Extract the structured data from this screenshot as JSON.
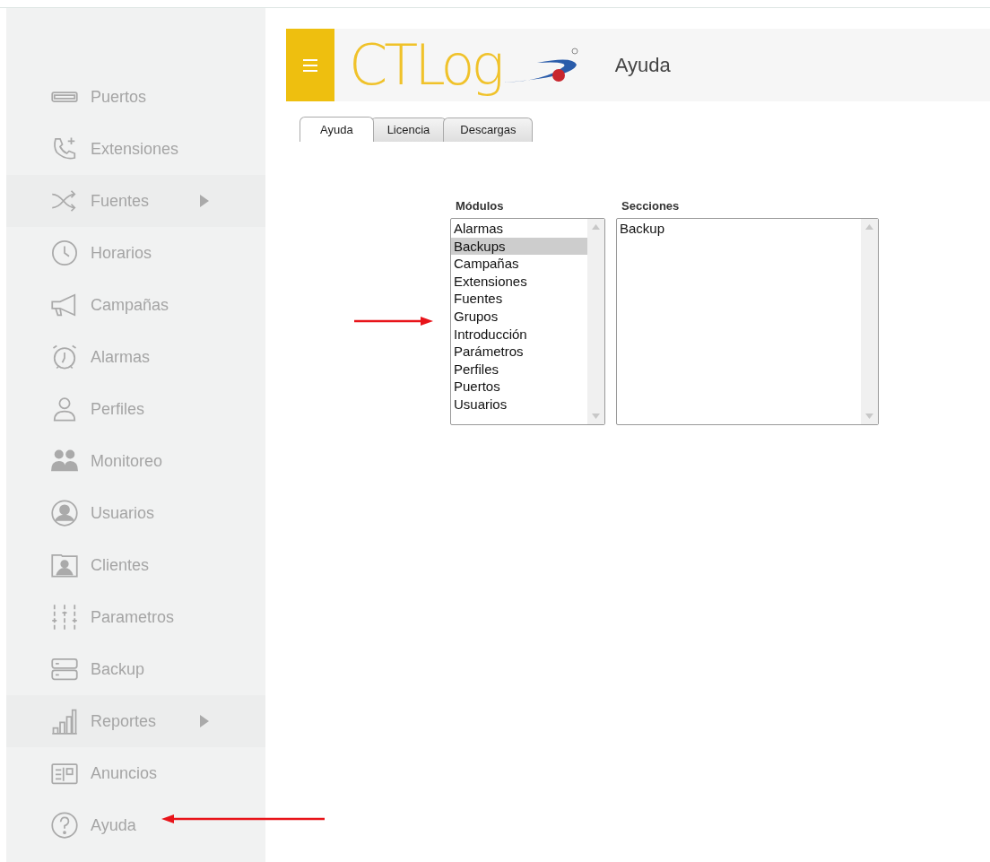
{
  "sidebar": {
    "items": [
      {
        "label": "Puertos",
        "has_submenu": false
      },
      {
        "label": "Extensiones",
        "has_submenu": false
      },
      {
        "label": "Fuentes",
        "has_submenu": true
      },
      {
        "label": "Horarios",
        "has_submenu": false
      },
      {
        "label": "Campañas",
        "has_submenu": false
      },
      {
        "label": "Alarmas",
        "has_submenu": false
      },
      {
        "label": "Perfiles",
        "has_submenu": false
      },
      {
        "label": "Monitoreo",
        "has_submenu": false
      },
      {
        "label": "Usuarios",
        "has_submenu": false
      },
      {
        "label": "Clientes",
        "has_submenu": false
      },
      {
        "label": "Parametros",
        "has_submenu": false
      },
      {
        "label": "Backup",
        "has_submenu": false
      },
      {
        "label": "Reportes",
        "has_submenu": true
      },
      {
        "label": "Anuncios",
        "has_submenu": false
      },
      {
        "label": "Ayuda",
        "has_submenu": false
      }
    ]
  },
  "header": {
    "logo": "CTLog",
    "title": "Ayuda"
  },
  "tabs": [
    {
      "label": "Ayuda",
      "selected": true
    },
    {
      "label": "Licencia",
      "selected": false
    },
    {
      "label": "Descargas",
      "selected": false
    }
  ],
  "modules": {
    "label": "Módulos",
    "items": [
      {
        "label": "Alarmas",
        "selected": false
      },
      {
        "label": "Backups",
        "selected": true
      },
      {
        "label": "Campañas",
        "selected": false
      },
      {
        "label": "Extensiones",
        "selected": false
      },
      {
        "label": "Fuentes",
        "selected": false
      },
      {
        "label": "Grupos",
        "selected": false
      },
      {
        "label": "Introducción",
        "selected": false
      },
      {
        "label": "Parámetros",
        "selected": false
      },
      {
        "label": "Perfiles",
        "selected": false
      },
      {
        "label": "Puertos",
        "selected": false
      },
      {
        "label": "Usuarios",
        "selected": false
      }
    ]
  },
  "sections": {
    "label": "Secciones",
    "items": [
      {
        "label": "Backup",
        "selected": false
      }
    ]
  }
}
